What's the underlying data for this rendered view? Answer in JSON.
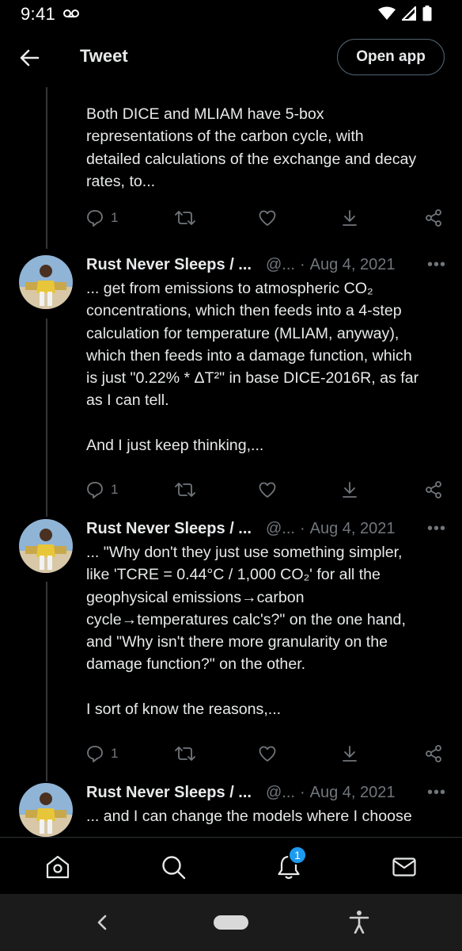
{
  "status_bar": {
    "time": "9:41"
  },
  "header": {
    "title": "Tweet",
    "open_app_label": "Open app"
  },
  "tweets": [
    {
      "author": "",
      "handle": "",
      "date": "",
      "text": "Both DICE and MLIAM have 5-box\nrepresentations of the carbon cycle, with\ndetailed calculations of the exchange and decay\nrates, to...",
      "replies": "1"
    },
    {
      "author": "Rust Never Sleeps / ...",
      "handle": "@...",
      "dot": "·",
      "date": "Aug 4, 2021",
      "more": "•••",
      "text": "... get from emissions to atmospheric CO₂\nconcentrations, which then feeds into a 4-step\ncalculation for temperature (MLIAM, anyway),\nwhich then feeds into a damage function, which\nis just \"0.22% * ΔT²\" in base DICE-2016R, as far\nas I can tell.\n\nAnd I just keep thinking,...",
      "replies": "1"
    },
    {
      "author": "Rust Never Sleeps / ...",
      "handle": "@...",
      "dot": "·",
      "date": "Aug 4, 2021",
      "more": "•••",
      "text": "... \"Why don't they just use something simpler,\nlike 'TCRE = 0.44°C / 1,000 CO₂' for all the\ngeophysical emissions→carbon\ncycle→temperatures calc's?\" on the one hand,\nand \"Why isn't there more granularity on the\ndamage function?\" on the other.\n\nI sort of know the reasons,...",
      "replies": "1"
    },
    {
      "author": "Rust Never Sleeps / ...",
      "handle": "@...",
      "dot": "·",
      "date": "Aug 4, 2021",
      "more": "•••",
      "text": "... and I can change the models where I choose",
      "replies": ""
    }
  ],
  "bottom_nav": {
    "items": [
      "home-icon",
      "search-icon",
      "bell-icon",
      "mail-icon"
    ],
    "notification_count": "1"
  },
  "colors": {
    "accent": "#1d9bf0",
    "muted": "#71767b",
    "background": "#000000",
    "text": "#e7e9ea"
  }
}
